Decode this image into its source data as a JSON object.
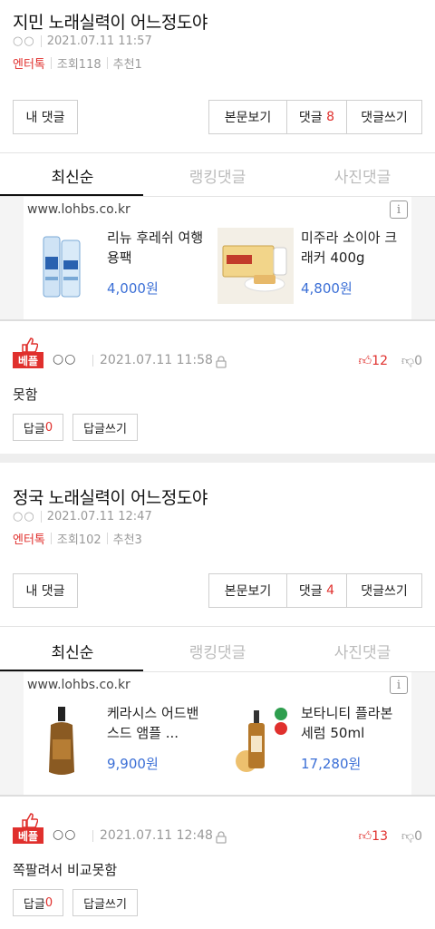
{
  "posts": [
    {
      "title": "지민 노래실력이 어느정도야",
      "author": "○○",
      "date": "2021.07.11 11:57",
      "category": "엔터톡",
      "views": "조회118",
      "recommend": "추천1",
      "my_comment": "내 댓글",
      "view_body": "본문보기",
      "comments_label": "댓글",
      "comments_count": "8",
      "write_comment": "댓글쓰기",
      "tabs": [
        "최신순",
        "랭킹댓글",
        "사진댓글"
      ],
      "ad": {
        "url": "www.lohbs.co.kr",
        "info_icon": "i",
        "items": [
          {
            "name": "리뉴 후레쉬 여행용팩",
            "price": "4,000원"
          },
          {
            "name": "미주라 소이아 크래커 400g",
            "price": "4,800원"
          }
        ]
      },
      "comment": {
        "badge": "베플",
        "author": "○○",
        "date": "2021.07.11 11:58",
        "text": "못함",
        "up": "12",
        "down": "0",
        "reply_label": "답글",
        "reply_count": "0",
        "write_reply": "답글쓰기"
      }
    },
    {
      "title": "정국 노래실력이 어느정도야",
      "author": "○○",
      "date": "2021.07.11 12:47",
      "category": "엔터톡",
      "views": "조회102",
      "recommend": "추천3",
      "my_comment": "내 댓글",
      "view_body": "본문보기",
      "comments_label": "댓글",
      "comments_count": "4",
      "write_comment": "댓글쓰기",
      "tabs": [
        "최신순",
        "랭킹댓글",
        "사진댓글"
      ],
      "ad": {
        "url": "www.lohbs.co.kr",
        "info_icon": "i",
        "items": [
          {
            "name": "케라시스 어드밴스드 앰플 ...",
            "price": "9,900원"
          },
          {
            "name": "보타니티 플라본 세럼 50ml",
            "price": "17,280원"
          }
        ]
      },
      "comment": {
        "badge": "베플",
        "author": "○○",
        "date": "2021.07.11 12:48",
        "text": "쪽팔려서 비교못함",
        "up": "13",
        "down": "0",
        "reply_label": "답글",
        "reply_count": "0",
        "write_reply": "답글쓰기"
      }
    }
  ],
  "colors": {
    "accent_red": "#e0302d",
    "price_blue": "#3b6fd6",
    "band_gray": "#eeeeee"
  }
}
